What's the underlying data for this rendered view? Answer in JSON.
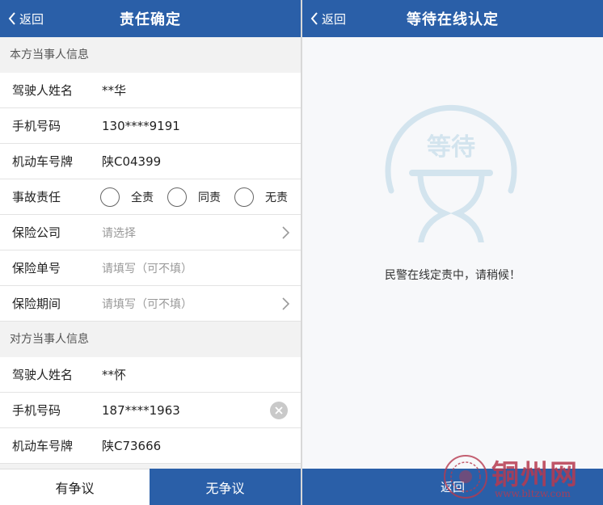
{
  "left": {
    "nav": {
      "back": "返回",
      "title": "责任确定"
    },
    "own_section": "本方当事人信息",
    "own": {
      "driver_label": "驾驶人姓名",
      "driver_value": "**华",
      "phone_label": "手机号码",
      "phone_value": "130****9191",
      "plate_label": "机动车号牌",
      "plate_value": "陕C04399",
      "liability_label": "事故责任",
      "liability_options": [
        "全责",
        "同责",
        "无责"
      ],
      "insurer_label": "保险公司",
      "insurer_placeholder": "请选择",
      "policy_label": "保险单号",
      "policy_placeholder": "请填写（可不填）",
      "period_label": "保险期间",
      "period_placeholder": "请填写（可不填）"
    },
    "other_section": "对方当事人信息",
    "other": {
      "driver_label": "驾驶人姓名",
      "driver_value": "**怀",
      "phone_label": "手机号码",
      "phone_value": "187****1963",
      "plate_label": "机动车号牌",
      "plate_value": "陕C73666"
    },
    "buttons": {
      "dispute": "有争议",
      "no_dispute": "无争议"
    }
  },
  "right": {
    "nav": {
      "back": "返回",
      "title": "等待在线认定"
    },
    "icon_text": "等待",
    "message": "民警在线定责中，请稍候！",
    "bottom_button": "返回"
  },
  "watermark": {
    "name": "铜州网",
    "url": "www.bltzw.com"
  },
  "colors": {
    "primary": "#2a5fa8",
    "icon": "#d3e4ee",
    "watermark": "#b73a4f"
  }
}
